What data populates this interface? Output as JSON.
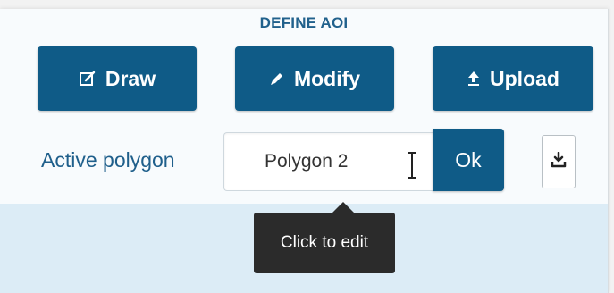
{
  "section": {
    "title": "DEFINE AOI"
  },
  "toolbar": {
    "draw": {
      "label": "Draw",
      "icon": "edit-square-icon"
    },
    "modify": {
      "label": "Modify",
      "icon": "pencil-icon"
    },
    "upload": {
      "label": "Upload",
      "icon": "upload-icon"
    }
  },
  "active_polygon": {
    "label": "Active polygon",
    "value": "Polygon 2",
    "ok_label": "Ok",
    "download_icon": "download-icon"
  },
  "tooltip": {
    "text": "Click to edit"
  },
  "colors": {
    "primary": "#0f5b87",
    "label_text": "#1f5f8b",
    "panel_band": "#dcecf6",
    "tooltip_bg": "#2b2b2b"
  }
}
